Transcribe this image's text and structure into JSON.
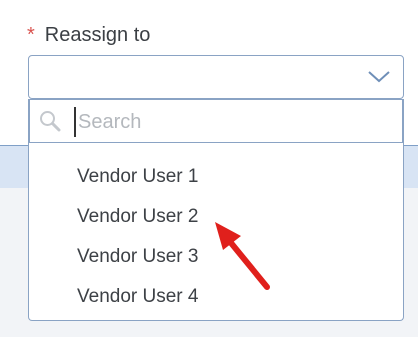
{
  "field": {
    "required_marker": "*",
    "label": "Reassign to"
  },
  "select": {
    "selected_value": "",
    "chevron_icon": "chevron-down-icon"
  },
  "search": {
    "placeholder": "Search",
    "icon": "search-icon"
  },
  "options": [
    {
      "label": "Vendor User 1"
    },
    {
      "label": "Vendor User 2"
    },
    {
      "label": "Vendor User 3"
    },
    {
      "label": "Vendor User 4"
    }
  ],
  "annotation": {
    "arrow_icon": "red-arrow-icon",
    "color": "#e0201c"
  },
  "colors": {
    "required": "#d9534f",
    "border": "#8aa3c4",
    "band": "#d8e4f4"
  }
}
